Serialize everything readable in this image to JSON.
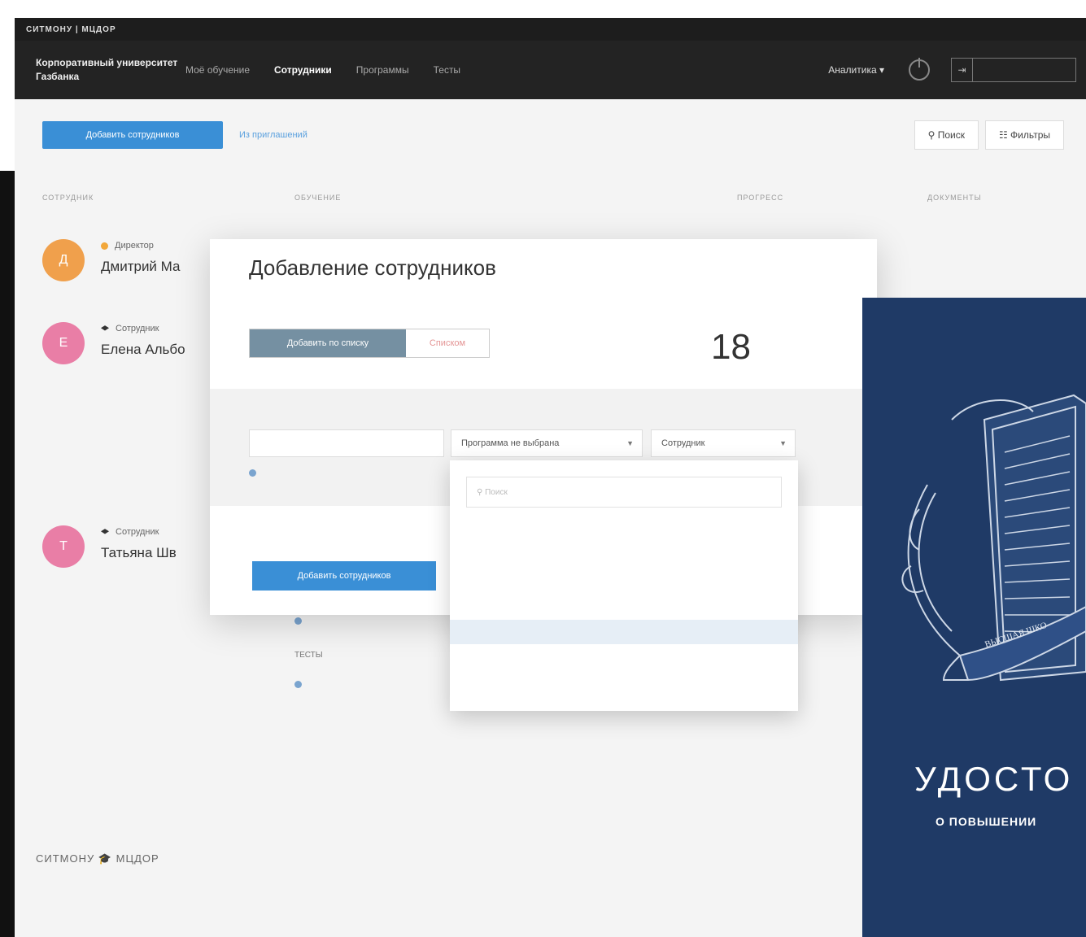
{
  "topstrip": {
    "brand": "СИТМОНУ | МЦДОР",
    "right_text": ""
  },
  "navbar": {
    "university": "Корпоративный университет Газбанка",
    "items": [
      "Моё обучение",
      "Сотрудники",
      "Программы",
      "Тесты"
    ],
    "active_index": 1,
    "account_dropdown": "Аналитика ▾",
    "account_label": "",
    "logout_glyph": "⇥"
  },
  "toolbar": {
    "add_button": "Добавить сотрудников",
    "link": "Из приглашений",
    "search_button": "⚲ Поиск",
    "filters_button": "☷ Фильтры"
  },
  "table": {
    "columns": [
      "Сотрудник",
      "Обучение",
      "Прогресс",
      "Документы"
    ]
  },
  "employees": [
    {
      "initial": "Д",
      "role": "Директор",
      "name": "Дмитрий Ма",
      "email": "",
      "color": "#f0a04c",
      "role_icon_color": "#f2a73a"
    },
    {
      "initial": "Е",
      "role": "Сотрудник",
      "name": "Елена Альбо",
      "email": "",
      "color": "#e97ea6",
      "role_icon_color": "#333333"
    },
    {
      "initial": "Т",
      "role": "Сотрудник",
      "name": "Татьяна Шв",
      "email": "",
      "color": "#e97ea6",
      "role_icon_color": "#333333"
    }
  ],
  "background_courses": {
    "item1": "",
    "label": "ТЕСТЫ",
    "item2": ""
  },
  "footer": {
    "logo": "СИТМОНУ 🎓 МЦДОР",
    "copyright": "",
    "links": [
      "",
      "",
      "",
      "",
      ""
    ]
  },
  "modal": {
    "title": "Добавление сотрудников",
    "subtitle": "",
    "seg_active": "Добавить по списку",
    "seg_inactive": "Списком",
    "counter_value": "18",
    "counter_label": "",
    "labels": {
      "email": "",
      "program": "",
      "role": ""
    },
    "email_value": "",
    "program_value": "Программа не выбрана",
    "role_value": "Сотрудник",
    "add_row_link": "",
    "summary": "",
    "submit_button": "Добавить сотрудников"
  },
  "dropdown": {
    "search_placeholder": "⚲ Поиск",
    "items": [
      {
        "text": ""
      },
      {
        "text": ""
      }
    ],
    "group_label": "",
    "items_after": [
      {
        "text": "",
        "highlighted": true
      },
      {
        "text": ""
      },
      {
        "text": ""
      }
    ]
  },
  "certificate": {
    "title": "УДОСТО",
    "subtitle": "О ПОВЫШЕНИИ",
    "ribbon_text": "ВЫСШАЯ ШКО"
  }
}
